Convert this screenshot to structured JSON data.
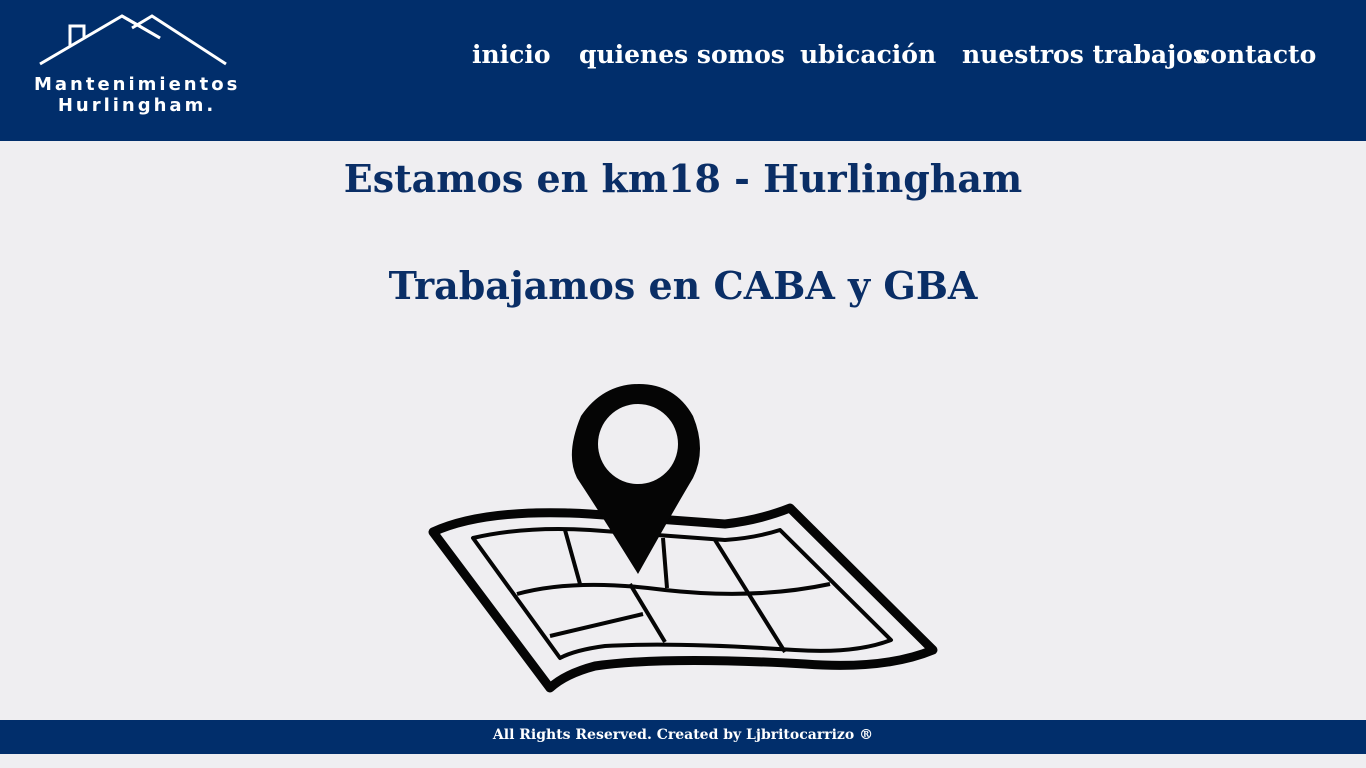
{
  "header": {
    "logo": {
      "line1": "Mantenimientos",
      "line2": "Hurlingham."
    },
    "nav": {
      "inicio": "inicio",
      "quienes_somos": "quienes somos",
      "ubicacion": "ubicación",
      "nuestros_trabajos": "nuestros trabajos",
      "contacto": "contacto"
    }
  },
  "main": {
    "heading1": "Estamos en km18 - Hurlingham",
    "heading2": "Trabajamos en CABA y GBA",
    "illustration_icon": "map-location-pin-icon"
  },
  "footer": {
    "text": "All Rights Reserved. Created by Ljbritocarrizo ®"
  },
  "colors": {
    "brand_blue": "#012e6b",
    "heading_blue": "#0a2e66",
    "background": "#efeef1"
  }
}
